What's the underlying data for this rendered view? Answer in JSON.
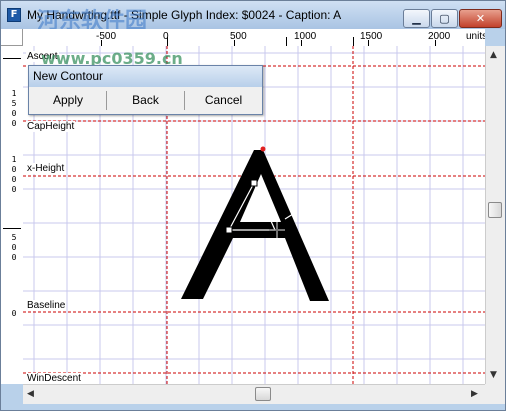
{
  "window": {
    "title": "My Handwrting.ttf - Simple Glyph Index: $0024 - Caption: A",
    "icon": "app-icon"
  },
  "watermark": {
    "brand": "河东软件园",
    "url": "www.pc0359.cn"
  },
  "ruler_top": {
    "labels": [
      "500",
      "1000",
      "1500",
      "2000"
    ],
    "neg_label": "-500",
    "zero_label": "0",
    "units_label": "units"
  },
  "ruler_left": {
    "groups": [
      [
        "1",
        "5",
        "0",
        "0"
      ],
      [
        "1",
        "0",
        "0",
        "0"
      ],
      [
        "5",
        "0",
        "0"
      ],
      [
        "0"
      ]
    ]
  },
  "metric_lines": {
    "ascent": "Ascent",
    "capheight": "CapHeight",
    "xheight": "x-Height",
    "baseline": "Baseline",
    "windescent": "WinDescent"
  },
  "dialog": {
    "title": "New Contour",
    "apply": "Apply",
    "back": "Back",
    "cancel": "Cancel"
  },
  "colors": {
    "grid": "#c9c9ee",
    "guide": "#cc0000",
    "glyph": "#000000",
    "titlebar": "#b9d1ea"
  }
}
